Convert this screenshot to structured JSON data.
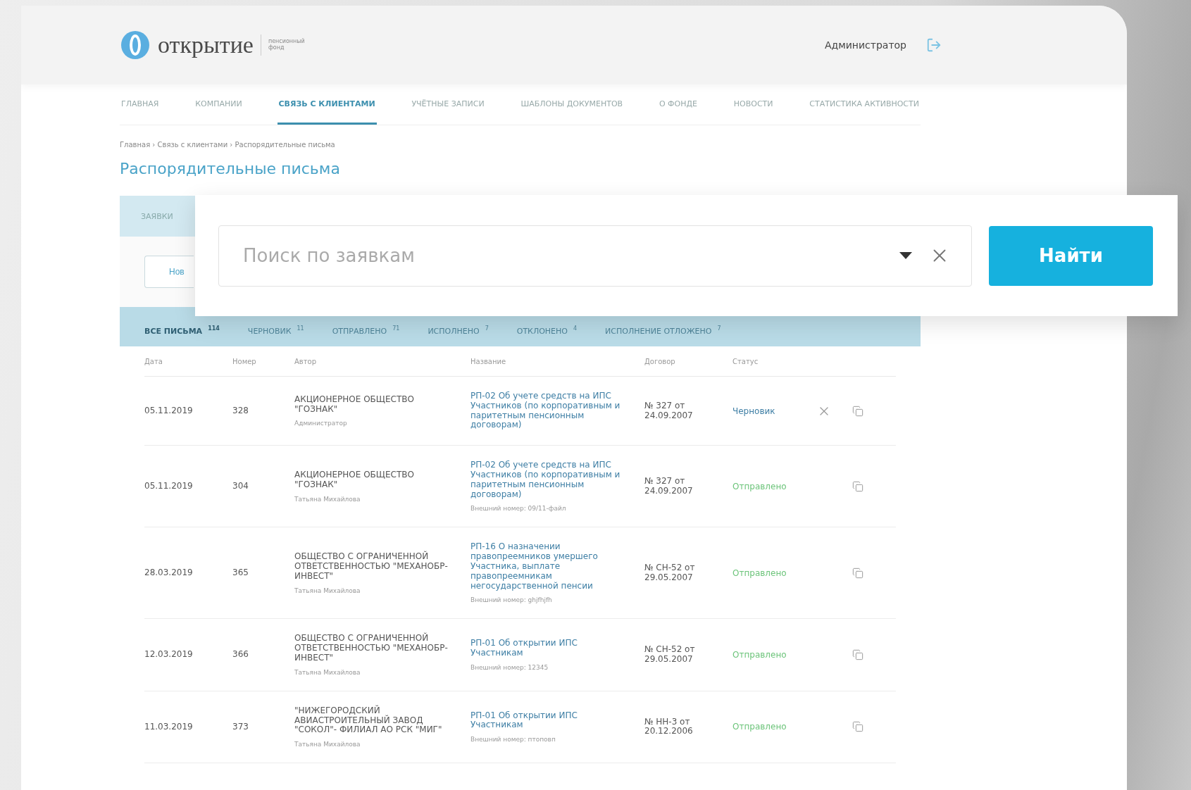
{
  "header": {
    "logo_text": "открытие",
    "logo_subtitle": "пенсионный фонд",
    "user": "Администратор"
  },
  "nav": [
    {
      "label": "ГЛАВНАЯ",
      "selected": false
    },
    {
      "label": "КОМПАНИИ",
      "selected": false
    },
    {
      "label": "СВЯЗЬ С КЛИЕНТАМИ",
      "selected": true
    },
    {
      "label": "УЧЁТНЫЕ ЗАПИСИ",
      "selected": false
    },
    {
      "label": "ШАБЛОНЫ ДОКУМЕНТОВ",
      "selected": false
    },
    {
      "label": "О ФОНДЕ",
      "selected": false
    },
    {
      "label": "НОВОСТИ",
      "selected": false
    },
    {
      "label": "СТАТИСТИКА АКТИВНОСТИ",
      "selected": false
    }
  ],
  "breadcrumbs": "Главная › Связь с клиентами › Распорядительные письма",
  "page_title": "Распорядительные письма",
  "section_tab": "ЗАЯВКИ",
  "new_button": "Нов",
  "filter_tabs": [
    {
      "label": "ВСЕ ПИСЬМА",
      "count": "114",
      "selected": true
    },
    {
      "label": "ЧЕРНОВИК",
      "count": "11",
      "selected": false
    },
    {
      "label": "ОТПРАВЛЕНО",
      "count": "71",
      "selected": false
    },
    {
      "label": "ИСПОЛНЕНО",
      "count": "7",
      "selected": false
    },
    {
      "label": "ОТКЛОНЕНО",
      "count": "4",
      "selected": false
    },
    {
      "label": "ИСПОЛНЕНИЕ ОТЛОЖЕНО",
      "count": "7",
      "selected": false
    }
  ],
  "table": {
    "columns": [
      "Дата",
      "Номер",
      "Автор",
      "Название",
      "Договор",
      "Статус"
    ],
    "rows": [
      {
        "date": "05.11.2019",
        "number": "328",
        "author": "АКЦИОНЕРНОЕ ОБЩЕСТВО \"ГОЗНАК\"",
        "author_user": "Администратор",
        "title": "РП-02 Об учете средств на ИПС Участников (по корпоративным и паритетным пенсионным договорам)",
        "contract": "№ 327 от 24.09.2007",
        "status": "Черновик",
        "color": "#3f7fa5",
        "deletable": true
      },
      {
        "date": "05.11.2019",
        "number": "304",
        "author": "АКЦИОНЕРНОЕ ОБЩЕСТВО \"ГОЗНАК\"",
        "author_user": "Татьяна Михайлова",
        "title": "РП-02 Об учете средств на ИПС Участников (по корпоративным и паритетным пенсионным договорам)",
        "external_number": "Внешний номер: 09/11-файл",
        "contract": "№ 327 от 24.09.2007",
        "status": "Отправлено",
        "color": "#6cc47a",
        "deletable": false
      },
      {
        "date": "28.03.2019",
        "number": "365",
        "author": "ОБЩЕСТВО С ОГРАНИЧЕННОЙ ОТВЕТСТВЕННОСТЬЮ \"МЕХАНОБР-ИНВЕСТ\"",
        "author_user": "Татьяна Михайлова",
        "title": "РП-16 О назначении правопреемников умершего Участника, выплате правопреемникам негосударственной пенсии",
        "external_number": "Внешний номер: ghjfhjfh",
        "contract": "№ СН-52 от 29.05.2007",
        "status": "Отправлено",
        "color": "#6cc47a",
        "deletable": false
      },
      {
        "date": "12.03.2019",
        "number": "366",
        "author": "ОБЩЕСТВО С ОГРАНИЧЕННОЙ ОТВЕТСТВЕННОСТЬЮ \"МЕХАНОБР-ИНВЕСТ\"",
        "author_user": "Татьяна Михайлова",
        "title": "РП-01 Об открытии ИПС Участникам",
        "external_number": "Внешний номер: 12345",
        "contract": "№ СН-52 от 29.05.2007",
        "status": "Отправлено",
        "color": "#6cc47a",
        "deletable": false
      },
      {
        "date": "11.03.2019",
        "number": "373",
        "author": "\"НИЖЕГОРОДСКИЙ АВИАСТРОИТЕЛЬНЫЙ ЗАВОД \"СОКОЛ\"- ФИЛИАЛ АО РСК \"МИГ\"",
        "author_user": "Татьяна Михайлова",
        "title": "РП-01 Об открытии ИПС Участникам",
        "external_number": "Внешний номер: птоповп",
        "contract": "№ НН-3 от 20.12.2006",
        "status": "Отправлено",
        "color": "#6cc47a",
        "deletable": false
      }
    ]
  },
  "search": {
    "placeholder": "Поиск по заявкам",
    "button": "Найти"
  }
}
